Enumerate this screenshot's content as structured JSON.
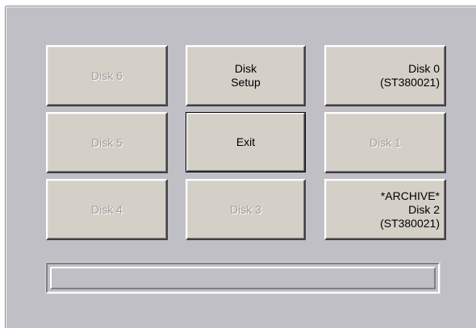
{
  "buttons": {
    "disk6": "Disk 6",
    "disk_setup": "Disk\nSetup",
    "disk0": "Disk 0\n(ST380021)",
    "disk5": "Disk 5",
    "exit": "Exit",
    "disk1": "Disk 1",
    "disk4": "Disk 4",
    "disk3": "Disk 3",
    "disk2": "*ARCHIVE*\nDisk 2\n(ST380021)"
  },
  "progress": {
    "fraction": 0
  },
  "colors": {
    "panel": "#c0bfc6",
    "button_face": "#d4d0c8",
    "disabled_text": "#a09e98"
  }
}
